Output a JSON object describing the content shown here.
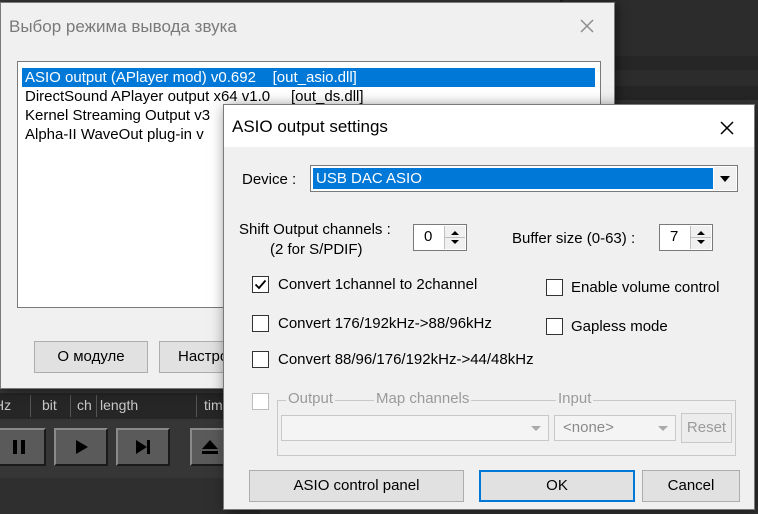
{
  "player": {
    "columns": [
      "Hz",
      "bit",
      "ch",
      "length",
      "time"
    ],
    "buttons": [
      "pause-icon",
      "play-icon",
      "next-icon",
      "eject-icon"
    ]
  },
  "output_dialog": {
    "title": "Выбор режима вывода звука",
    "plugins": [
      "ASIO output (APlayer mod) v0.692    [out_asio.dll]",
      "DirectSound APlayer output x64 v1.0     [out_ds.dll]",
      "Kernel Streaming Output v3",
      "Alpha-II WaveOut plug-in v"
    ],
    "selected_index": 0,
    "about_button": "О модуле",
    "settings_button": "Настро"
  },
  "asio_dialog": {
    "title": "ASIO output settings",
    "device_label": "Device :",
    "device_value": "USB DAC ASIO",
    "shift_label_1": "Shift Output channels :",
    "shift_label_2": "(2 for S/PDIF)",
    "shift_value": "0",
    "buffer_label": "Buffer size (0-63) :",
    "buffer_value": "7",
    "options": {
      "convert_1ch": {
        "label": "Convert 1channel to 2channel",
        "checked": true
      },
      "enable_volume": {
        "label": "Enable volume control",
        "checked": false
      },
      "convert_176": {
        "label": "Convert 176/192kHz->88/96kHz",
        "checked": false
      },
      "gapless": {
        "label": "Gapless mode",
        "checked": false
      },
      "convert_88": {
        "label": "Convert 88/96/176/192kHz->44/48kHz",
        "checked": false
      }
    },
    "map": {
      "output_label": "Output",
      "map_channels_label": "Map channels",
      "input_label": "Input",
      "input_value": "<none>",
      "reset_button": "Reset"
    },
    "control_panel_button": "ASIO control panel",
    "ok_button": "OK",
    "cancel_button": "Cancel"
  },
  "colors": {
    "selection": "#0078d7",
    "dialog_bg": "#f0f0f0",
    "player_bg": "#363636"
  }
}
